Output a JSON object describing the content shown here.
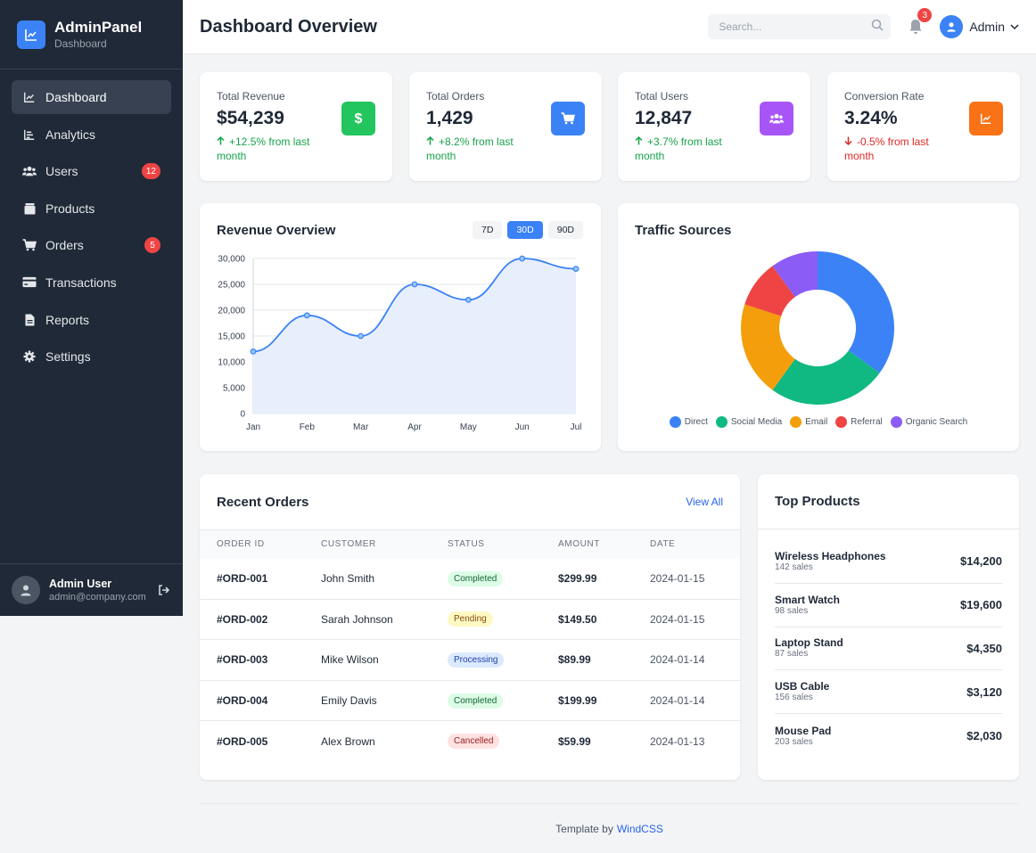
{
  "brand": {
    "title": "AdminPanel",
    "subtitle": "Dashboard"
  },
  "sidebar": {
    "items": [
      {
        "label": "Dashboard",
        "icon": "chart-line-icon",
        "active": true,
        "badge": ""
      },
      {
        "label": "Analytics",
        "icon": "bar-chart-icon",
        "active": false,
        "badge": ""
      },
      {
        "label": "Users",
        "icon": "users-icon",
        "active": false,
        "badge": "12"
      },
      {
        "label": "Products",
        "icon": "box-icon",
        "active": false,
        "badge": ""
      },
      {
        "label": "Orders",
        "icon": "cart-icon",
        "active": false,
        "badge": "5"
      },
      {
        "label": "Transactions",
        "icon": "credit-card-icon",
        "active": false,
        "badge": ""
      },
      {
        "label": "Reports",
        "icon": "file-icon",
        "active": false,
        "badge": ""
      },
      {
        "label": "Settings",
        "icon": "gear-icon",
        "active": false,
        "badge": ""
      }
    ],
    "user": {
      "name": "Admin User",
      "email": "admin@company.com"
    }
  },
  "header": {
    "title": "Dashboard Overview",
    "search_placeholder": "Search...",
    "notification_count": "3",
    "account_label": "Admin"
  },
  "stats": [
    {
      "label": "Total Revenue",
      "value": "$54,239",
      "change": "+12.5% from last month",
      "direction": "up",
      "icon": "dollar-icon",
      "color": "#22c55e"
    },
    {
      "label": "Total Orders",
      "value": "1,429",
      "change": "+8.2% from last month",
      "direction": "up",
      "icon": "cart-icon",
      "color": "#3b82f6"
    },
    {
      "label": "Total Users",
      "value": "12,847",
      "change": "+3.7% from last month",
      "direction": "up",
      "icon": "users-icon",
      "color": "#a855f7"
    },
    {
      "label": "Conversion Rate",
      "value": "3.24%",
      "change": "-0.5% from last month",
      "direction": "down",
      "icon": "chart-line-icon",
      "color": "#f97316"
    }
  ],
  "revenue": {
    "title": "Revenue Overview",
    "ranges": [
      "7D",
      "30D",
      "90D"
    ],
    "active_range": "30D"
  },
  "traffic": {
    "title": "Traffic Sources"
  },
  "chart_data": [
    {
      "type": "area",
      "title": "Revenue Overview",
      "categories": [
        "Jan",
        "Feb",
        "Mar",
        "Apr",
        "May",
        "Jun",
        "Jul"
      ],
      "values": [
        12000,
        19000,
        15000,
        25000,
        22000,
        30000,
        28000
      ],
      "ylim": [
        0,
        30000
      ],
      "yticks": [
        "0",
        "5,000",
        "10,000",
        "15,000",
        "20,000",
        "25,000",
        "30,000"
      ],
      "grid": true,
      "color": "#3b82f6",
      "fill": "#e8effc"
    },
    {
      "type": "pie",
      "donut": true,
      "title": "Traffic Sources",
      "labels": [
        "Direct",
        "Social Media",
        "Email",
        "Referral",
        "Organic Search"
      ],
      "values": [
        35,
        25,
        20,
        10,
        10
      ],
      "colors": [
        "#3b82f6",
        "#10b981",
        "#f59e0b",
        "#ef4444",
        "#8b5cf6"
      ],
      "legend": "bottom"
    }
  ],
  "orders": {
    "title": "Recent Orders",
    "view_all": "View All",
    "columns": [
      "ORDER ID",
      "CUSTOMER",
      "STATUS",
      "AMOUNT",
      "DATE"
    ],
    "rows": [
      {
        "id": "#ORD-001",
        "customer": "John Smith",
        "status": "Completed",
        "status_bg": "#dcfce7",
        "status_fg": "#166534",
        "amount": "$299.99",
        "date": "2024-01-15"
      },
      {
        "id": "#ORD-002",
        "customer": "Sarah Johnson",
        "status": "Pending",
        "status_bg": "#fef9c3",
        "status_fg": "#854d0e",
        "amount": "$149.50",
        "date": "2024-01-15"
      },
      {
        "id": "#ORD-003",
        "customer": "Mike Wilson",
        "status": "Processing",
        "status_bg": "#dbeafe",
        "status_fg": "#1e40af",
        "amount": "$89.99",
        "date": "2024-01-14"
      },
      {
        "id": "#ORD-004",
        "customer": "Emily Davis",
        "status": "Completed",
        "status_bg": "#dcfce7",
        "status_fg": "#166534",
        "amount": "$199.99",
        "date": "2024-01-14"
      },
      {
        "id": "#ORD-005",
        "customer": "Alex Brown",
        "status": "Cancelled",
        "status_bg": "#fee2e2",
        "status_fg": "#991b1b",
        "amount": "$59.99",
        "date": "2024-01-13"
      }
    ]
  },
  "top_products": {
    "title": "Top Products",
    "items": [
      {
        "name": "Wireless Headphones",
        "sales": "142 sales",
        "amount": "$14,200"
      },
      {
        "name": "Smart Watch",
        "sales": "98 sales",
        "amount": "$19,600"
      },
      {
        "name": "Laptop Stand",
        "sales": "87 sales",
        "amount": "$4,350"
      },
      {
        "name": "USB Cable",
        "sales": "156 sales",
        "amount": "$3,120"
      },
      {
        "name": "Mouse Pad",
        "sales": "203 sales",
        "amount": "$2,030"
      }
    ]
  },
  "footer": {
    "text": "Template by",
    "link": "WindCSS"
  }
}
